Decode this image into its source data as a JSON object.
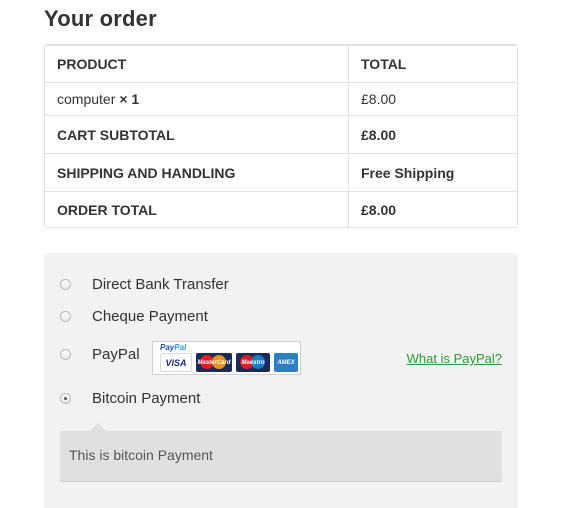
{
  "order": {
    "title": "Your order",
    "headers": {
      "product": "PRODUCT",
      "total": "TOTAL"
    },
    "item": {
      "name": "computer",
      "qty": "× 1",
      "total": "£8.00"
    },
    "subtotal": {
      "label": "CART SUBTOTAL",
      "value": "£8.00"
    },
    "shipping": {
      "label": "SHIPPING AND HANDLING",
      "value": "Free Shipping"
    },
    "grand_total": {
      "label": "ORDER TOTAL",
      "value": "£8.00"
    }
  },
  "payment": {
    "methods": [
      {
        "label": "Direct Bank Transfer",
        "selected": false
      },
      {
        "label": "Cheque Payment",
        "selected": false
      },
      {
        "label": "PayPal",
        "selected": false
      },
      {
        "label": "Bitcoin Payment",
        "selected": true
      }
    ],
    "paypal_logo": {
      "brand": "PayPal",
      "cards": [
        "VISA",
        "MasterCard",
        "Maestro",
        "AMERICAN EXPRESS"
      ]
    },
    "what_is_paypal": "What is PayPal?",
    "selected_description": "This is bitcoin Payment"
  },
  "colors": {
    "link": "#2a9c2a",
    "panel_bg": "#f2f2f2",
    "description_bg": "#e2dfe0"
  }
}
